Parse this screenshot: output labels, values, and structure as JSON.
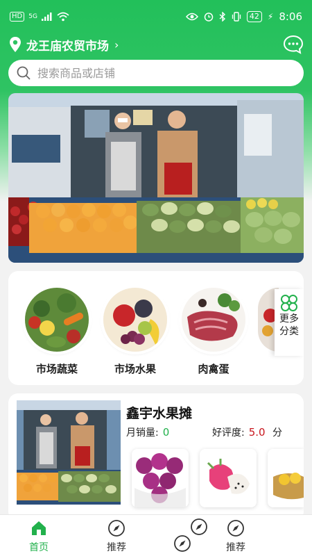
{
  "status_bar": {
    "left_badge": "HD",
    "signal": "5G",
    "battery": "42",
    "time": "8:06"
  },
  "location": {
    "name": "龙王庙农贸市场",
    "arrow": "›"
  },
  "search": {
    "placeholder": "搜索商品或店铺"
  },
  "categories": [
    {
      "label": "市场蔬菜"
    },
    {
      "label": "市场水果"
    },
    {
      "label": "肉禽蛋"
    }
  ],
  "more_categories": {
    "label_line1": "更多",
    "label_line2": "分类"
  },
  "shop": {
    "name": "鑫宇水果摊",
    "monthly_sales_label": "月销量:",
    "monthly_sales_value": "0",
    "rating_label": "好评度:",
    "rating_value": "5.0",
    "rating_unit": "分"
  },
  "tabbar": {
    "items": [
      {
        "label": "首页",
        "icon": "home-icon",
        "active": true
      },
      {
        "label": "推荐",
        "icon": "compass-icon"
      },
      {
        "label": "推荐",
        "icon": "compass-icon"
      }
    ]
  },
  "colors": {
    "brand_green": "#22b14c",
    "rating_red": "#c8161d"
  }
}
